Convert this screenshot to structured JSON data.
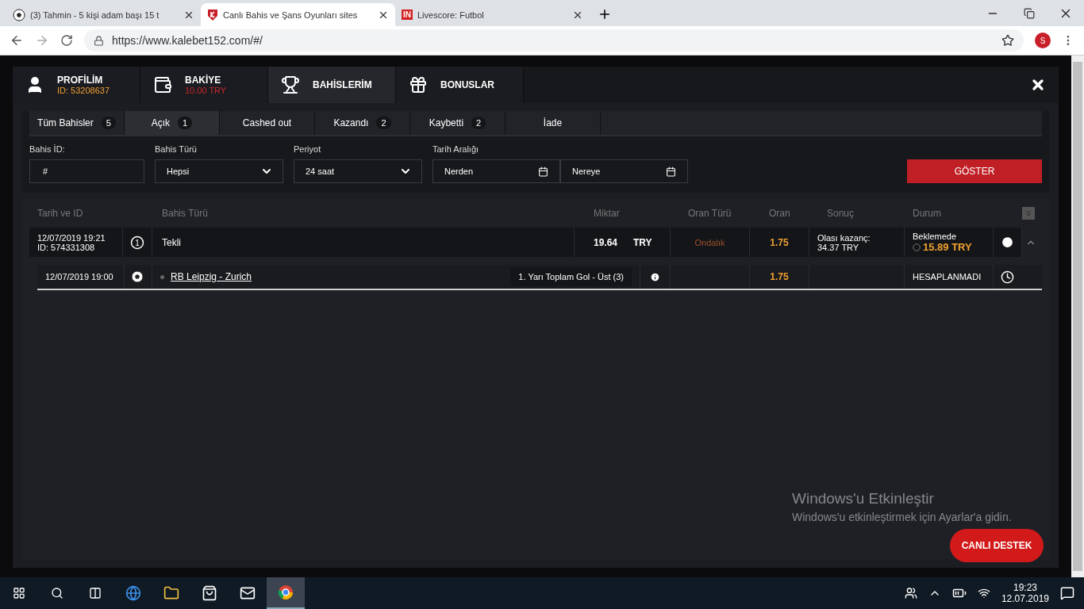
{
  "browser": {
    "tabs": [
      {
        "kind": "ball",
        "title": "(3) Tahmin - 5 kişi adam başı 15 t",
        "selected": false
      },
      {
        "kind": "shield",
        "title": "Canlı Bahis ve Şans Oyunları sites",
        "selected": true
      },
      {
        "kind": "logo",
        "logo": "IN",
        "title": "Livescore: Futbol",
        "selected": false
      }
    ],
    "url": "https://www.kalebet152.com/#/",
    "avatar": "S"
  },
  "nav": [
    {
      "kind": "profile",
      "label": "PROFİLİM",
      "sub": "ID: 53208637",
      "color": "#f0a030",
      "selected": false
    },
    {
      "kind": "balance",
      "label": "BAKİYE",
      "sub": "10.00 TRY",
      "color": "#c8282a",
      "selected": false
    },
    {
      "kind": "bets",
      "label": "BAHİSLERİM",
      "selected": true
    },
    {
      "kind": "bonus",
      "label": "BONUSLAR",
      "selected": false
    }
  ],
  "status_tabs": [
    {
      "label": "Tüm Bahisler",
      "count": "5",
      "selected": false
    },
    {
      "label": "Açık",
      "count": "1",
      "selected": true
    },
    {
      "label": "Cashed out",
      "selected": false
    },
    {
      "label": "Kazandı",
      "count": "2",
      "selected": false
    },
    {
      "label": "Kaybetti",
      "count": "2",
      "selected": false
    },
    {
      "label": "İade",
      "selected": false
    }
  ],
  "filters": {
    "bet_id": {
      "label": "Bahis İD:",
      "placeholder": "#"
    },
    "bet_type": {
      "label": "Bahis Türü",
      "value": "Hepsi"
    },
    "period": {
      "label": "Periyot",
      "value": "24 saat"
    },
    "date_range": {
      "label": "Tarih Aralığı",
      "from_placeholder": "Nerden",
      "to_placeholder": "Nereye"
    },
    "show_button": "GÖSTER"
  },
  "table": {
    "columns": [
      "Tarih ve ID",
      "Bahis Türü",
      "Miktar",
      "Oran Türü",
      "Oran",
      "Sonuç",
      "Durum"
    ],
    "rows": [
      {
        "date": "12/07/2019 19:21",
        "id": "ID: 574331308",
        "type_mark": "1",
        "type": "Tekli",
        "amount": "19.64",
        "currency": "TRY",
        "odds_type": "Ondalık",
        "odds": "1.75",
        "result_label": "Olası kazanç:",
        "result_value": "34.37 TRY",
        "status": "Beklemede",
        "cashout": "15.89 TRY",
        "expanded": true,
        "children": [
          {
            "date": "12/07/2019 19:00",
            "event": "RB Leipzig - Zurich",
            "market": "1. Yarı Toplam Gol - Üst (3)",
            "odds": "1.75",
            "status": "HESAPLANMADI"
          }
        ]
      }
    ]
  },
  "support_button": "CANLI DESTEK",
  "activation": {
    "title": "Windows'u Etkinleştir",
    "text": "Windows'u etkinleştirmek için Ayarlar'a gidin."
  },
  "taskbar": {
    "time": "19:23",
    "date": "12.07.2019"
  }
}
